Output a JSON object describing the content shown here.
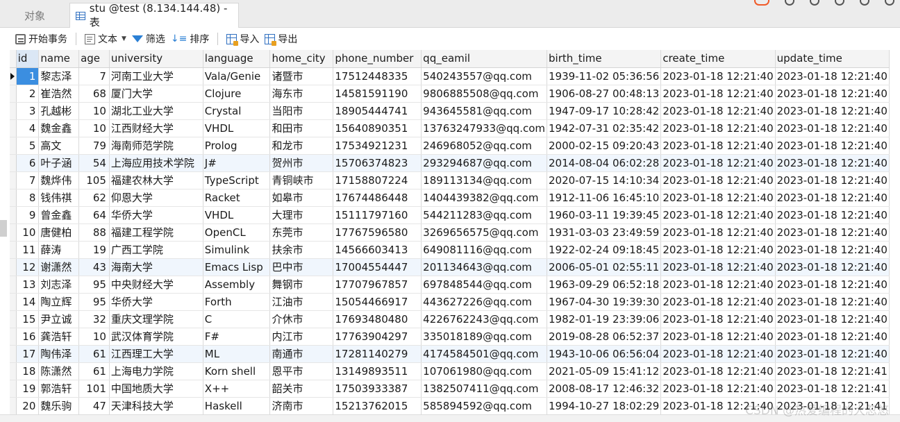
{
  "tabs": {
    "objects": "对象",
    "active": "stu @test (8.134.144.48) - 表"
  },
  "toolbar": {
    "begin": "开始事务",
    "text": "文本",
    "filter": "筛选",
    "sort": "排序",
    "import": "导入",
    "export": "导出"
  },
  "columns": [
    "id",
    "name",
    "age",
    "university",
    "language",
    "home_city",
    "phone_number",
    "qq_eamil",
    "birth_time",
    "create_time",
    "update_time"
  ],
  "rows": [
    [
      "1",
      "黎志泽",
      "7",
      "河南工业大学",
      "Vala/Genie",
      "诸暨市",
      "17512448335",
      "540243557@qq.com",
      "1939-11-02 05:36:56",
      "2023-01-18 12:21:40",
      "2023-01-18 12:21:40"
    ],
    [
      "2",
      "崔浩然",
      "68",
      "厦门大学",
      "Clojure",
      "海东市",
      "14581591190",
      "9806885508@qq.com",
      "1906-08-27 00:48:13",
      "2023-01-18 12:21:40",
      "2023-01-18 12:21:40"
    ],
    [
      "3",
      "孔越彬",
      "10",
      "湖北工业大学",
      "Crystal",
      "当阳市",
      "18905444741",
      "943645581@qq.com",
      "1947-09-17 10:28:42",
      "2023-01-18 12:21:40",
      "2023-01-18 12:21:40"
    ],
    [
      "4",
      "魏金鑫",
      "10",
      "江西财经大学",
      "VHDL",
      "和田市",
      "15640890351",
      "13763247933@qq.com",
      "1942-07-31 02:35:42",
      "2023-01-18 12:21:40",
      "2023-01-18 12:21:40"
    ],
    [
      "5",
      "高文",
      "79",
      "海南师范学院",
      "Prolog",
      "和龙市",
      "17534921231",
      "246968052@qq.com",
      "2000-02-15 09:20:43",
      "2023-01-18 12:21:40",
      "2023-01-18 12:21:40"
    ],
    [
      "6",
      "叶子涵",
      "54",
      "上海应用技术学院",
      "J#",
      "贺州市",
      "15706374823",
      "293294687@qq.com",
      "2014-08-04 06:02:28",
      "2023-01-18 12:21:40",
      "2023-01-18 12:21:40"
    ],
    [
      "7",
      "魏烨伟",
      "105",
      "福建农林大学",
      "TypeScript",
      "青铜峡市",
      "17158807224",
      "189113134@qq.com",
      "2020-07-15 14:10:34",
      "2023-01-18 12:21:40",
      "2023-01-18 12:21:40"
    ],
    [
      "8",
      "钱伟祺",
      "62",
      "仰恩大学",
      "Racket",
      "如皋市",
      "17674486448",
      "1404439382@qq.com",
      "1912-11-06 16:45:10",
      "2023-01-18 12:21:40",
      "2023-01-18 12:21:40"
    ],
    [
      "9",
      "曾金鑫",
      "64",
      "华侨大学",
      "VHDL",
      "大理市",
      "15111797160",
      "544211283@qq.com",
      "1960-03-11 19:39:45",
      "2023-01-18 12:21:40",
      "2023-01-18 12:21:40"
    ],
    [
      "10",
      "唐健柏",
      "88",
      "福建工程学院",
      "OpenCL",
      "东莞市",
      "17767596580",
      "3269656575@qq.com",
      "1931-03-03 23:49:59",
      "2023-01-18 12:21:40",
      "2023-01-18 12:21:40"
    ],
    [
      "11",
      "薛涛",
      "19",
      "广西工学院",
      "Simulink",
      "扶余市",
      "14566603413",
      "649081116@qq.com",
      "1922-02-24 09:18:45",
      "2023-01-18 12:21:40",
      "2023-01-18 12:21:40"
    ],
    [
      "12",
      "谢潇然",
      "43",
      "海南大学",
      "Emacs Lisp",
      "巴中市",
      "17004554447",
      "201134643@qq.com",
      "2006-05-01 02:55:11",
      "2023-01-18 12:21:40",
      "2023-01-18 12:21:40"
    ],
    [
      "13",
      "刘志泽",
      "95",
      "中央财经大学",
      "Assembly",
      "舞钢市",
      "17707967857",
      "697848544@qq.com",
      "1963-09-29 06:52:18",
      "2023-01-18 12:21:40",
      "2023-01-18 12:21:40"
    ],
    [
      "14",
      "陶立辉",
      "95",
      "华侨大学",
      "Forth",
      "江油市",
      "15054466917",
      "443627226@qq.com",
      "1967-04-30 19:39:30",
      "2023-01-18 12:21:40",
      "2023-01-18 12:21:40"
    ],
    [
      "15",
      "尹立诚",
      "32",
      "重庆文理学院",
      "C",
      "介休市",
      "17693480480",
      "4226762243@qq.com",
      "1982-01-19 23:39:06",
      "2023-01-18 12:21:40",
      "2023-01-18 12:21:40"
    ],
    [
      "16",
      "龚浩轩",
      "10",
      "武汉体育学院",
      "F#",
      "内江市",
      "17763904297",
      "335018189@qq.com",
      "2019-08-28 06:52:37",
      "2023-01-18 12:21:40",
      "2023-01-18 12:21:40"
    ],
    [
      "17",
      "陶伟泽",
      "61",
      "江西理工大学",
      "ML",
      "南通市",
      "17281140279",
      "4174584501@qq.com",
      "1943-10-06 06:56:04",
      "2023-01-18 12:21:40",
      "2023-01-18 12:21:40"
    ],
    [
      "18",
      "陈潇然",
      "61",
      "上海电力学院",
      "Korn shell",
      "恩平市",
      "13149893511",
      "107061980@qq.com",
      "2021-05-09 15:41:12",
      "2023-01-18 12:21:40",
      "2023-01-18 12:21:41"
    ],
    [
      "19",
      "郭浩轩",
      "101",
      "中国地质大学",
      "X++",
      "韶关市",
      "17503933387",
      "1382507411@qq.com",
      "2008-08-17 12:46:32",
      "2023-01-18 12:21:40",
      "2023-01-18 12:21:41"
    ],
    [
      "20",
      "魏乐驹",
      "47",
      "天津科技大学",
      "Haskell",
      "济南市",
      "15213762015",
      "585894592@qq.com",
      "1994-10-27 18:02:29",
      "2023-01-18 12:21:40",
      "2023-01-18 12:21:41"
    ]
  ],
  "selected_row_index": 0,
  "watermark": "CSDN @热爱编程的大忽悠"
}
